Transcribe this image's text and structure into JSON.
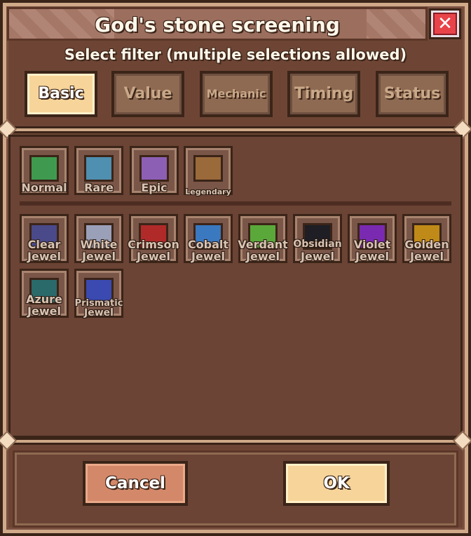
{
  "dialog": {
    "title": "God's stone screening",
    "close_label": "✕",
    "subtitle": "Select filter (multiple selections allowed)"
  },
  "tabs": [
    {
      "label": "Basic",
      "active": true
    },
    {
      "label": "Value",
      "active": false
    },
    {
      "label": "Mechanic",
      "active": false
    },
    {
      "label": "Timing",
      "active": false
    },
    {
      "label": "Status",
      "active": false
    }
  ],
  "rarity_filters": [
    {
      "label": "Normal",
      "color": "#3f9a4f"
    },
    {
      "label": "Rare",
      "color": "#4f8fb0"
    },
    {
      "label": "Epic",
      "color": "#8d5fb4"
    },
    {
      "label": "Legendary",
      "color": "#9a6a3a"
    }
  ],
  "jewel_filters": [
    {
      "line1": "Clear",
      "line2": "Jewel",
      "color": "#4a4a8a"
    },
    {
      "line1": "White",
      "line2": "Jewel",
      "color": "#9aa0b8"
    },
    {
      "line1": "Crimson",
      "line2": "Jewel",
      "color": "#b02a2a"
    },
    {
      "line1": "Cobalt",
      "line2": "Jewel",
      "color": "#3a78c0"
    },
    {
      "line1": "Verdant",
      "line2": "Jewel",
      "color": "#5aa83a"
    },
    {
      "line1": "Obsidian",
      "line2": "Jewel",
      "color": "#1e1e24"
    },
    {
      "line1": "Violet",
      "line2": "Jewel",
      "color": "#7a2ab0"
    },
    {
      "line1": "Golden",
      "line2": "Jewel",
      "color": "#c08a18"
    },
    {
      "line1": "Azure",
      "line2": "Jewel",
      "color": "#2a6a6a"
    },
    {
      "line1": "Prismatic",
      "line2": "Jewel",
      "color": "#3a4ab0"
    }
  ],
  "buttons": {
    "cancel": "Cancel",
    "ok": "OK"
  }
}
